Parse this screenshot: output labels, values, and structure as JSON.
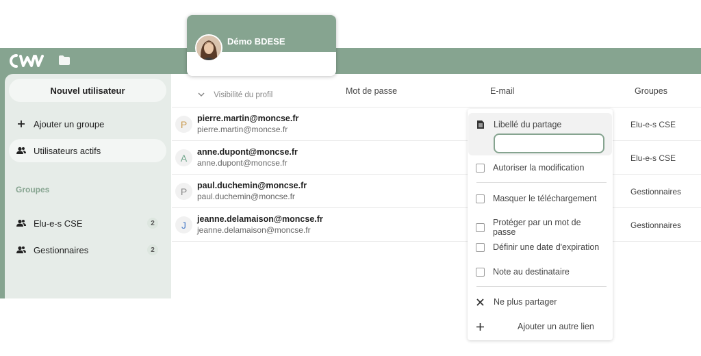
{
  "colors": {
    "brand": "#86a490",
    "sidebar_bg": "#e6ece8",
    "pill_bg": "#f3f6f4"
  },
  "header": {
    "logo_text": "CW",
    "folder_icon": "folder-icon"
  },
  "profile": {
    "name": "Démo BDESE"
  },
  "sidebar": {
    "new_user": "Nouvel utilisateur",
    "items": [
      {
        "label": "Ajouter un groupe",
        "icon": "plus-icon"
      },
      {
        "label": "Utilisateurs actifs",
        "icon": "users-icon"
      }
    ],
    "groups_heading": "Groupes",
    "groups": [
      {
        "label": "Elu-e-s CSE",
        "count": "2",
        "icon": "users-icon"
      },
      {
        "label": "Gestionnaires",
        "count": "2",
        "icon": "users-icon"
      }
    ]
  },
  "table": {
    "visibility_label": "Visibilité du profil",
    "columns": [
      "Mot de passe",
      "E-mail",
      "Groupes"
    ],
    "rows": [
      {
        "initial": "P",
        "name": "pierre.martin@moncse.fr",
        "sub": "pierre.martin@moncse.fr",
        "group": "Elu-e-s CSE",
        "avatar_color": "#c99a4f"
      },
      {
        "initial": "A",
        "name": "anne.dupont@moncse.fr",
        "sub": "anne.dupont@moncse.fr",
        "group": "Elu-e-s CSE",
        "avatar_color": "#6fa58a"
      },
      {
        "initial": "P",
        "name": "paul.duchemin@moncse.fr",
        "sub": "paul.duchemin@moncse.fr",
        "group": "Gestionnaires",
        "avatar_color": "#888888"
      },
      {
        "initial": "J",
        "name": "jeanne.delamaison@moncse.fr",
        "sub": "jeanne.delamaison@moncse.fr",
        "group": "Gestionnaires",
        "avatar_color": "#4f7fc9"
      }
    ]
  },
  "share_menu": {
    "label_title": "Libellé du partage",
    "label_value": "",
    "allow_edit": "Autoriser la modification",
    "hide_download": "Masquer le téléchargement",
    "password_protect": "Protéger par un mot de passe",
    "expiration": "Définir une date d'expiration",
    "note": "Note au destinataire",
    "unshare": "Ne plus partager",
    "add_link": "Ajouter un autre lien"
  }
}
